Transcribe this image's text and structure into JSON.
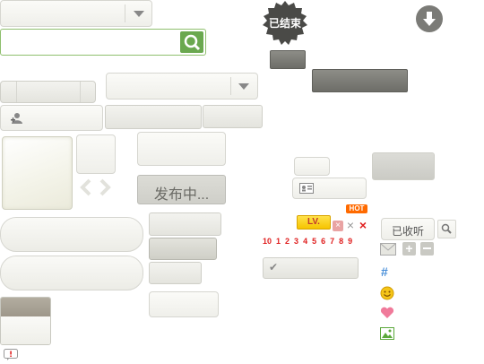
{
  "ended_badge": {
    "label": "已结束"
  },
  "publish_button": {
    "label": "发布中..."
  },
  "collected_button": {
    "label": "已收听"
  },
  "hot_badge": {
    "label": "HOT"
  },
  "level_badge": {
    "label": "LV."
  },
  "level_numbers": [
    "10",
    "1",
    "2",
    "3",
    "4",
    "5",
    "6",
    "7",
    "8",
    "9"
  ],
  "colors": {
    "search_green": "#6aa84f",
    "level_yellow": "#f6c400",
    "level_red": "#e02020",
    "hot_orange": "#ff6a00"
  },
  "icons": [
    "chevron-down-icon",
    "search-icon",
    "download-arrow-icon",
    "user-add-icon",
    "contact-card-icon",
    "close-x-icon",
    "mail-icon",
    "plus-icon",
    "minus-icon",
    "hashtag-icon",
    "smiley-icon",
    "heart-icon",
    "image-icon",
    "check-icon",
    "chevron-left-icon",
    "chevron-right-icon",
    "alert-icon"
  ]
}
